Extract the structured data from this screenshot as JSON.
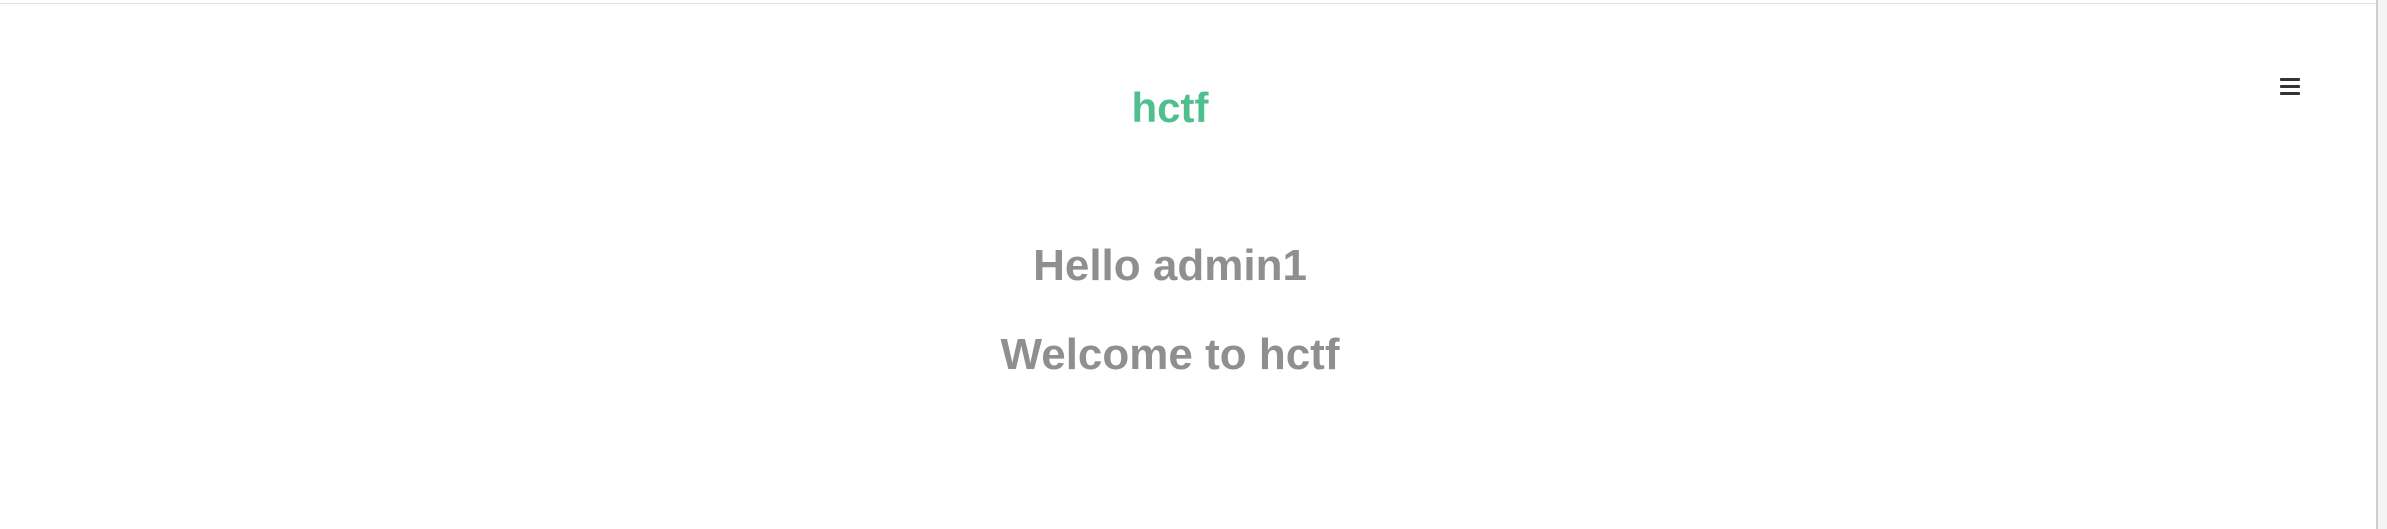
{
  "header": {
    "brand": "hctf",
    "menu_icon": "hamburger-menu-icon"
  },
  "main": {
    "greeting": "Hello admin1",
    "welcome": "Welcome to hctf"
  },
  "colors": {
    "brand": "#4fbf8f",
    "heading_text": "#8f8f8f",
    "icon": "#333333",
    "background": "#ffffff"
  }
}
